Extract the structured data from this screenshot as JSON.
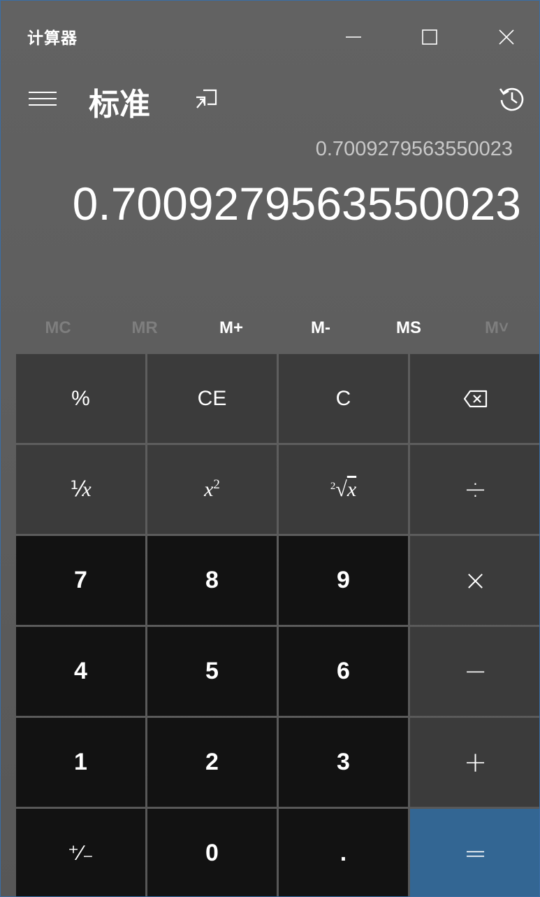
{
  "window": {
    "title": "计算器",
    "controls": [
      "minimize",
      "maximize",
      "close"
    ]
  },
  "header": {
    "mode_title": "标准",
    "menu_icon": "hamburger-icon",
    "keep_on_top_icon": "keep-on-top-icon",
    "history_icon": "history-icon"
  },
  "display": {
    "expression": "0.7009279563550023",
    "result": "0.7009279563550023"
  },
  "memory": [
    {
      "label": "MC",
      "enabled": false
    },
    {
      "label": "MR",
      "enabled": false
    },
    {
      "label": "M+",
      "enabled": true
    },
    {
      "label": "M-",
      "enabled": true
    },
    {
      "label": "MS",
      "enabled": true
    },
    {
      "label": "M˅",
      "enabled": false
    }
  ],
  "keys": {
    "percent": "%",
    "clear_entry": "CE",
    "clear": "C",
    "backspace_icon": "backspace-icon",
    "reciprocal": {
      "pre": "⅟",
      "var": "x"
    },
    "square": {
      "var": "x",
      "exp": "2"
    },
    "sqrt": {
      "index": "2",
      "radical": "√",
      "var": "x"
    },
    "divide": "÷",
    "seven": "7",
    "eight": "8",
    "nine": "9",
    "multiply": "×",
    "four": "4",
    "five": "5",
    "six": "6",
    "subtract": "−",
    "one": "1",
    "two": "2",
    "three": "3",
    "add": "+",
    "negate": "⁺∕₋",
    "zero": "0",
    "decimal": ".",
    "equals": "="
  },
  "colors": {
    "background": "#5f5f5f",
    "operator_key": "#3b3b3b",
    "number_key": "#121212",
    "equals_key": "#336693",
    "disabled_text": "#7e7e7e"
  }
}
